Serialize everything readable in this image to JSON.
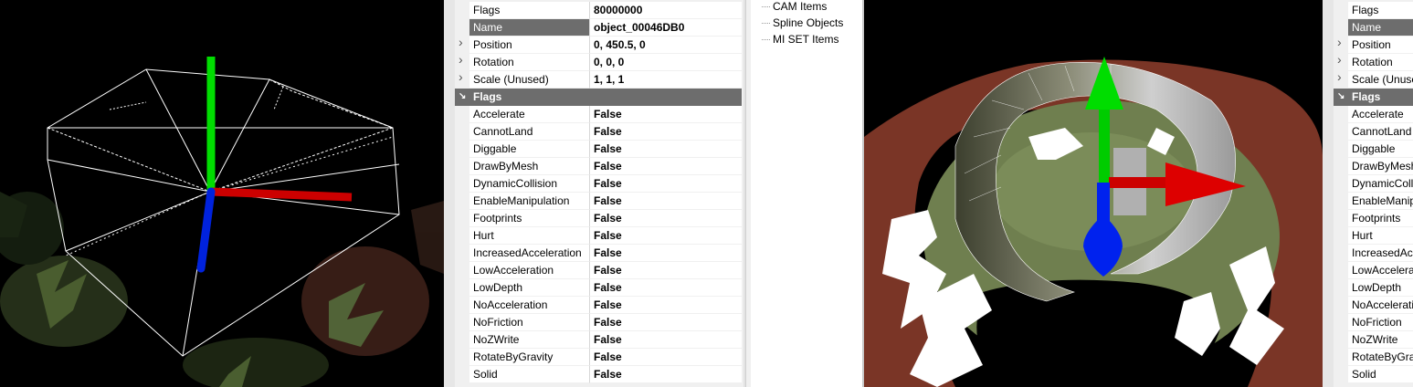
{
  "left_pane": {
    "rows": [
      {
        "kind": "prop",
        "name": "Flags",
        "value": "80000000"
      },
      {
        "kind": "prop",
        "name": "Name",
        "value": "object_00046DB0",
        "selected": true
      },
      {
        "kind": "prop",
        "name": "Position",
        "value": "0, 450.5, 0",
        "expandable": true
      },
      {
        "kind": "prop",
        "name": "Rotation",
        "value": "0, 0, 0",
        "expandable": true
      },
      {
        "kind": "prop",
        "name": "Scale (Unused)",
        "value": "1, 1, 1",
        "expandable": true
      },
      {
        "kind": "category",
        "name": "Flags"
      },
      {
        "kind": "prop",
        "name": "Accelerate",
        "value": "False"
      },
      {
        "kind": "prop",
        "name": "CannotLand",
        "value": "False"
      },
      {
        "kind": "prop",
        "name": "Diggable",
        "value": "False"
      },
      {
        "kind": "prop",
        "name": "DrawByMesh",
        "value": "False"
      },
      {
        "kind": "prop",
        "name": "DynamicCollision",
        "value": "False"
      },
      {
        "kind": "prop",
        "name": "EnableManipulation",
        "value": "False"
      },
      {
        "kind": "prop",
        "name": "Footprints",
        "value": "False"
      },
      {
        "kind": "prop",
        "name": "Hurt",
        "value": "False"
      },
      {
        "kind": "prop",
        "name": "IncreasedAcceleration",
        "value": "False"
      },
      {
        "kind": "prop",
        "name": "LowAcceleration",
        "value": "False"
      },
      {
        "kind": "prop",
        "name": "LowDepth",
        "value": "False"
      },
      {
        "kind": "prop",
        "name": "NoAcceleration",
        "value": "False"
      },
      {
        "kind": "prop",
        "name": "NoFriction",
        "value": "False"
      },
      {
        "kind": "prop",
        "name": "NoZWrite",
        "value": "False"
      },
      {
        "kind": "prop",
        "name": "RotateByGravity",
        "value": "False"
      },
      {
        "kind": "prop",
        "name": "Solid",
        "value": "False"
      }
    ]
  },
  "tree": {
    "items": [
      "CAM Items",
      "Spline Objects",
      "MI SET Items"
    ]
  },
  "right_pane": {
    "rows": [
      {
        "kind": "prop",
        "name": "Flags"
      },
      {
        "kind": "prop",
        "name": "Name",
        "selected": true
      },
      {
        "kind": "prop",
        "name": "Position",
        "expandable": true
      },
      {
        "kind": "prop",
        "name": "Rotation",
        "expandable": true
      },
      {
        "kind": "prop",
        "name": "Scale (Unused)",
        "expandable": true
      },
      {
        "kind": "category",
        "name": "Flags"
      },
      {
        "kind": "prop",
        "name": "Accelerate"
      },
      {
        "kind": "prop",
        "name": "CannotLand"
      },
      {
        "kind": "prop",
        "name": "Diggable"
      },
      {
        "kind": "prop",
        "name": "DrawByMesh"
      },
      {
        "kind": "prop",
        "name": "DynamicCollision"
      },
      {
        "kind": "prop",
        "name": "EnableManipulation"
      },
      {
        "kind": "prop",
        "name": "Footprints"
      },
      {
        "kind": "prop",
        "name": "Hurt"
      },
      {
        "kind": "prop",
        "name": "IncreasedAcceleration"
      },
      {
        "kind": "prop",
        "name": "LowAcceleration"
      },
      {
        "kind": "prop",
        "name": "LowDepth"
      },
      {
        "kind": "prop",
        "name": "NoAcceleration"
      },
      {
        "kind": "prop",
        "name": "NoFriction"
      },
      {
        "kind": "prop",
        "name": "NoZWrite"
      },
      {
        "kind": "prop",
        "name": "RotateByGravity"
      },
      {
        "kind": "prop",
        "name": "Solid"
      }
    ]
  },
  "icons": {
    "expander": "chevron-right-icon",
    "collapse": "chevron-down-icon"
  },
  "colors": {
    "gizmo_x": "#cc0000",
    "gizmo_y": "#00dd00",
    "gizmo_z": "#0022dd",
    "selection_row": "#6d6d6d",
    "category_row": "#6d6d6d"
  }
}
